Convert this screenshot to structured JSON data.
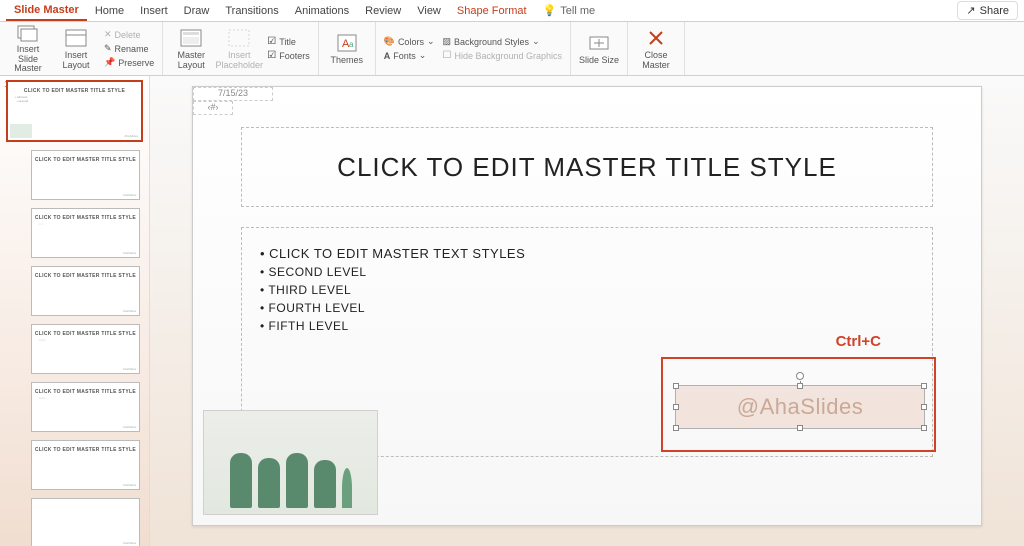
{
  "tabs": {
    "slide_master": "Slide Master",
    "home": "Home",
    "insert": "Insert",
    "draw": "Draw",
    "transitions": "Transitions",
    "animations": "Animations",
    "review": "Review",
    "view": "View",
    "shape_format": "Shape Format",
    "tell_me": "Tell me",
    "share": "Share"
  },
  "ribbon": {
    "insert_slide_master": "Insert Slide Master",
    "insert_layout": "Insert Layout",
    "delete": "Delete",
    "rename": "Rename",
    "preserve": "Preserve",
    "master_layout": "Master Layout",
    "insert_placeholder": "Insert Placeholder",
    "title_chk": "Title",
    "footers_chk": "Footers",
    "themes": "Themes",
    "colors": "Colors",
    "fonts": "Fonts",
    "background_styles": "Background Styles",
    "hide_bg": "Hide Background Graphics",
    "slide_size": "Slide Size",
    "close_master": "Close Master"
  },
  "slide": {
    "title": "CLICK TO EDIT MASTER TITLE STYLE",
    "body_levels": {
      "l1": "CLICK TO EDIT MASTER TEXT STYLES",
      "l2": "SECOND LEVEL",
      "l3": "THIRD LEVEL",
      "l4": "FOURTH LEVEL",
      "l5": "FIFTH LEVEL"
    },
    "date": "7/15/23",
    "slide_num": "‹#›",
    "watermark": "@AhaSlides"
  },
  "annotation": {
    "shortcut": "Ctrl+C"
  },
  "thumbs": {
    "master_title": "CLICK TO EDIT MASTER TITLE STYLE",
    "layout_title": "CLICK TO EDIT MASTER TITLE STYLE",
    "brand": "AhaSlides"
  }
}
